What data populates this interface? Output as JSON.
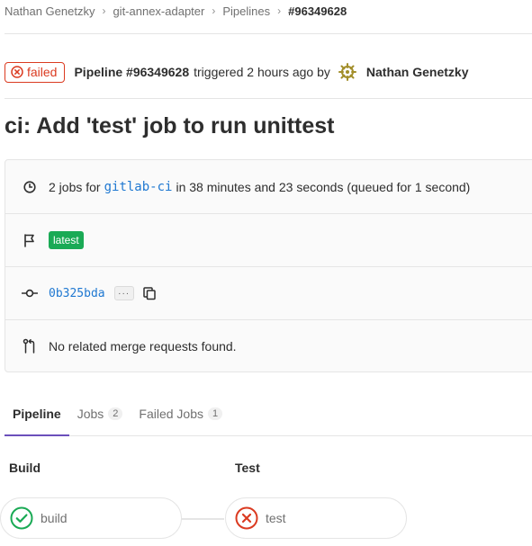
{
  "breadcrumb": {
    "items": [
      "Nathan Genetzky",
      "git-annex-adapter",
      "Pipelines"
    ],
    "current": "#96349628"
  },
  "header": {
    "status": "failed",
    "pipeline_label": "Pipeline #96349628",
    "triggered_text": "triggered 2 hours ago by",
    "author": "Nathan Genetzky"
  },
  "title": "ci: Add 'test' job to run unittest",
  "info": {
    "jobs_prefix": "2 jobs for",
    "runner": "gitlab-ci",
    "jobs_suffix": "in 38 minutes and 23 seconds (queued for 1 second)",
    "tag": "latest",
    "commit_sha": "0b325bda",
    "ellipsis": "···",
    "mr_text": "No related merge requests found."
  },
  "tabs": [
    {
      "label": "Pipeline",
      "active": true
    },
    {
      "label": "Jobs",
      "count": "2"
    },
    {
      "label": "Failed Jobs",
      "count": "1"
    }
  ],
  "stages": [
    {
      "title": "Build",
      "job": "build",
      "status": "success"
    },
    {
      "title": "Test",
      "job": "test",
      "status": "failed"
    }
  ],
  "colors": {
    "failed": "#db3b21",
    "success": "#1aaa55",
    "link": "#1f78d1",
    "active_tab": "#6b4fbb"
  },
  "icons": [
    "circle-x-icon",
    "user-avatar-icon",
    "clock-icon",
    "flag-icon",
    "commit-icon",
    "clipboard-icon",
    "merge-request-icon",
    "check-circle-icon",
    "x-circle-icon"
  ]
}
